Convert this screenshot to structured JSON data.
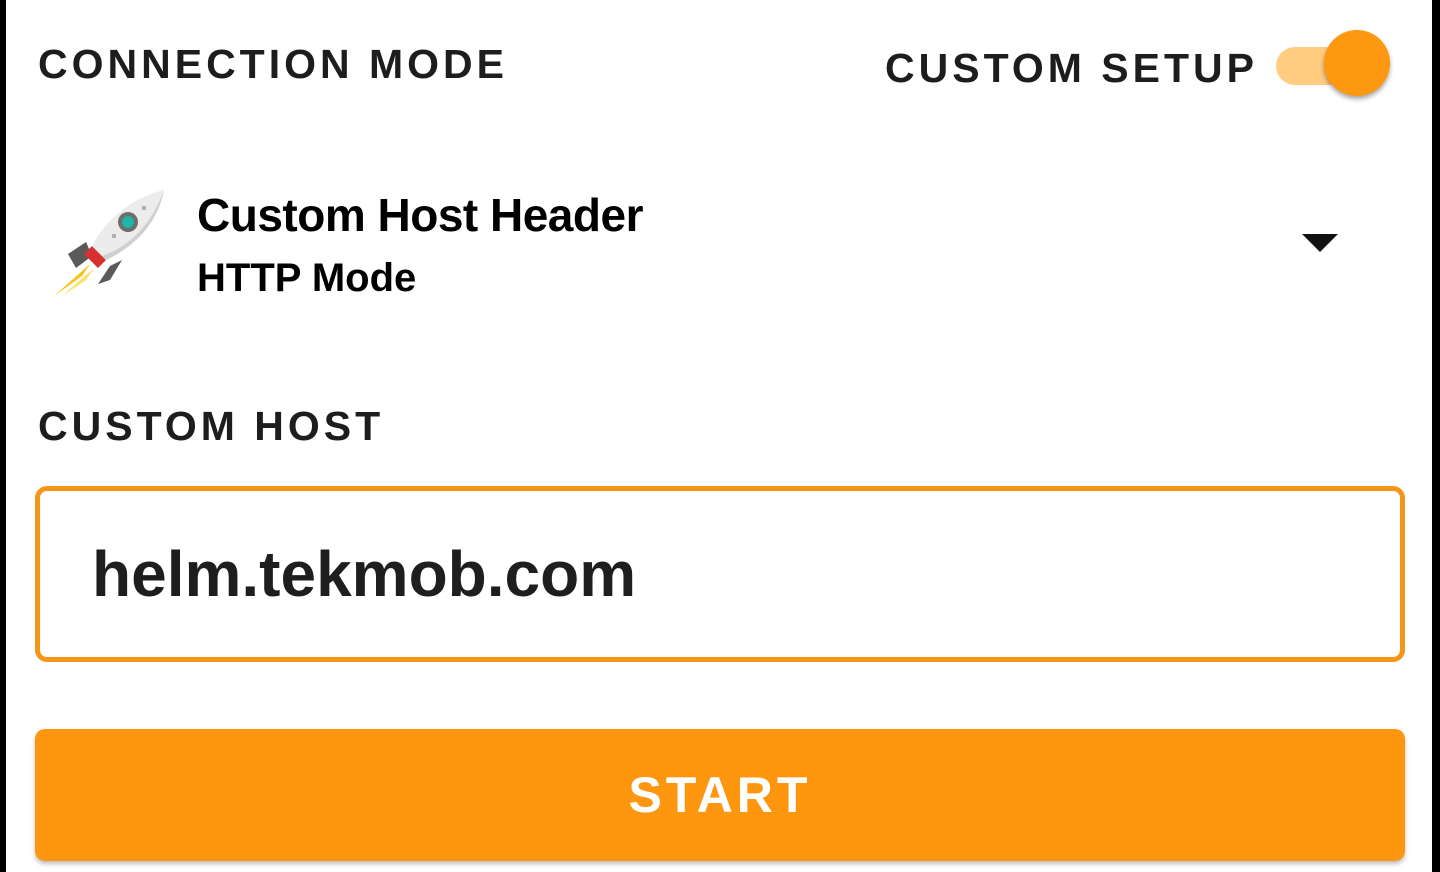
{
  "header": {
    "connection_mode_label": "CONNECTION MODE",
    "custom_setup_label": "CUSTOM SETUP",
    "custom_setup_enabled": true
  },
  "mode": {
    "title": "Custom Host Header",
    "subtitle": "HTTP Mode",
    "icon": "rocket-icon",
    "dropdown_icon": "dropdown-arrow-icon"
  },
  "custom_host": {
    "label": "CUSTOM HOST",
    "value": "helm.tekmob.com"
  },
  "actions": {
    "start_label": "START"
  },
  "colors": {
    "accent": "#ff960f",
    "accent_light": "#ffcc80",
    "input_border": "#f4961a",
    "text": "#1d1d1d"
  }
}
